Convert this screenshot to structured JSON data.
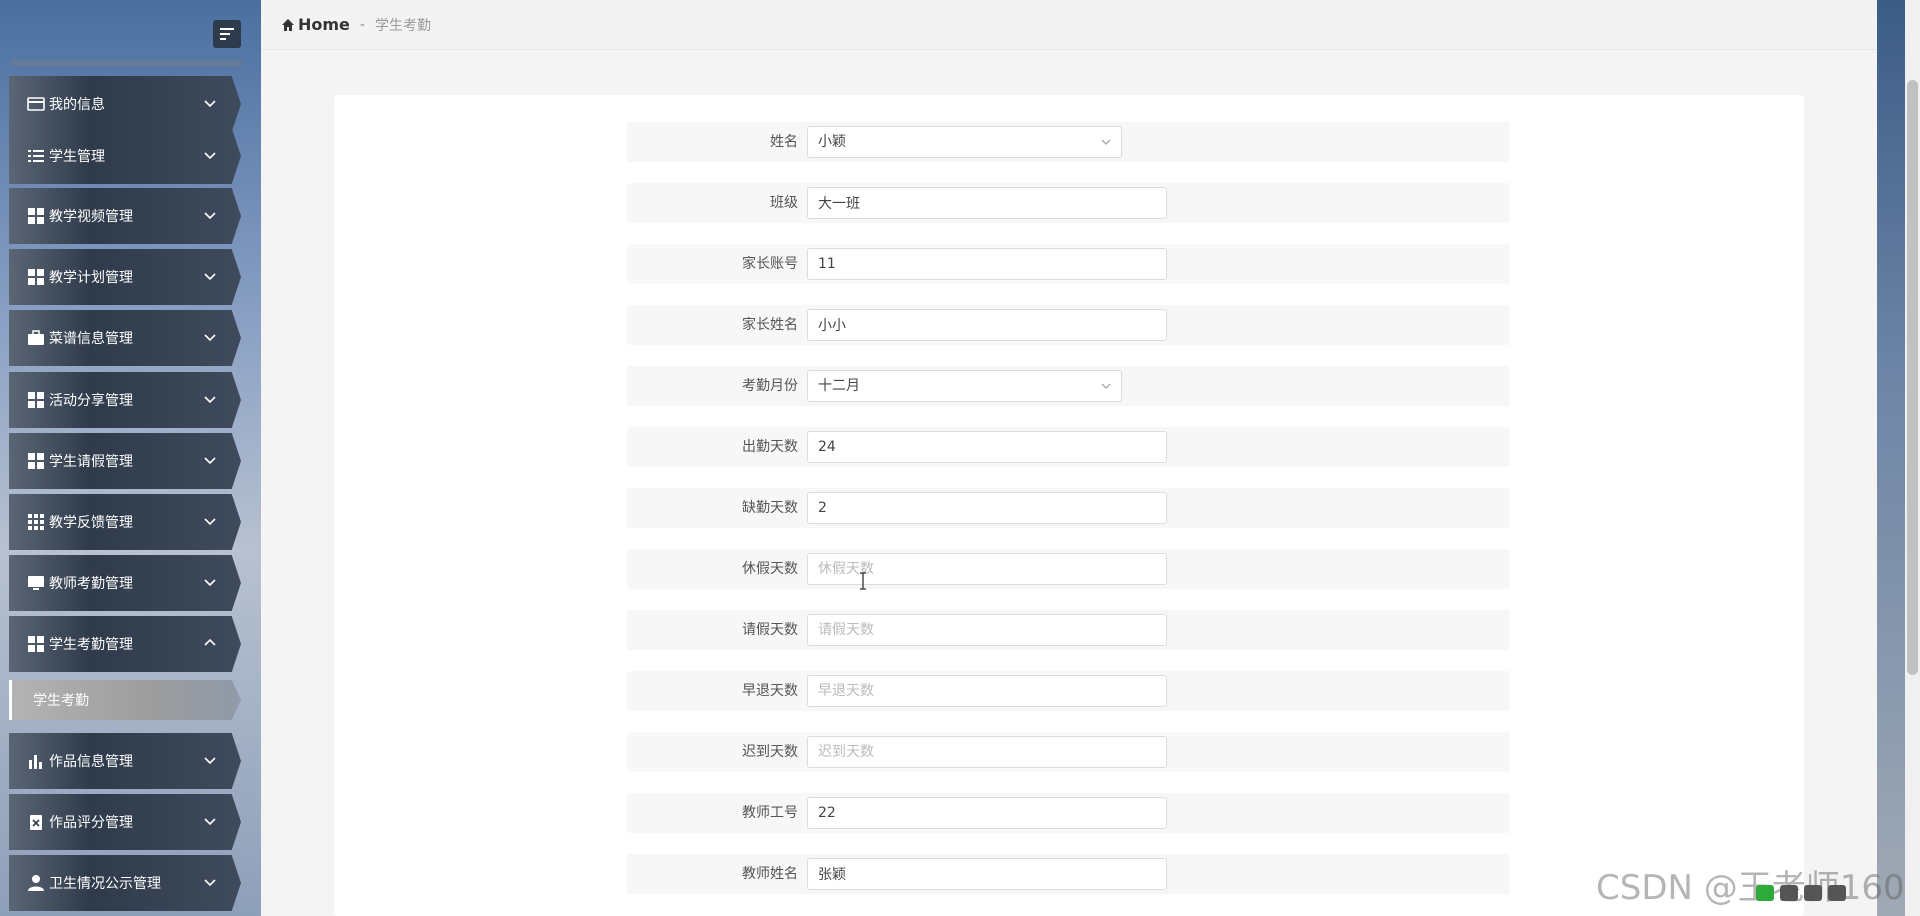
{
  "breadcrumb": {
    "home": "Home",
    "separator": "-",
    "current": "学生考勤"
  },
  "sidebar": {
    "items": [
      {
        "label": "我的信息",
        "icon": "wallet-icon"
      },
      {
        "label": "学生管理",
        "icon": "list-icon"
      },
      {
        "label": "教学视频管理",
        "icon": "grid-icon"
      },
      {
        "label": "教学计划管理",
        "icon": "grid-icon"
      },
      {
        "label": "菜谱信息管理",
        "icon": "briefcase-icon"
      },
      {
        "label": "活动分享管理",
        "icon": "grid-icon"
      },
      {
        "label": "学生请假管理",
        "icon": "grid-icon"
      },
      {
        "label": "教学反馈管理",
        "icon": "grid-3x3-icon"
      },
      {
        "label": "教师考勤管理",
        "icon": "monitor-icon"
      },
      {
        "label": "学生考勤管理",
        "icon": "grid-icon",
        "expanded": true
      },
      {
        "label": "作品信息管理",
        "icon": "bar-chart-icon"
      },
      {
        "label": "作品评分管理",
        "icon": "clipboard-x-icon"
      },
      {
        "label": "卫生情况公示管理",
        "icon": "user-icon"
      }
    ],
    "sub_item": "学生考勤"
  },
  "form": {
    "fields": [
      {
        "label": "姓名",
        "type": "select",
        "value": "小颖",
        "placeholder": ""
      },
      {
        "label": "班级",
        "type": "input",
        "value": "大一班",
        "placeholder": ""
      },
      {
        "label": "家长账号",
        "type": "input",
        "value": "11",
        "placeholder": ""
      },
      {
        "label": "家长姓名",
        "type": "input",
        "value": "小小",
        "placeholder": ""
      },
      {
        "label": "考勤月份",
        "type": "select",
        "value": "十二月",
        "placeholder": ""
      },
      {
        "label": "出勤天数",
        "type": "input",
        "value": "24",
        "placeholder": ""
      },
      {
        "label": "缺勤天数",
        "type": "input",
        "value": "2",
        "placeholder": ""
      },
      {
        "label": "休假天数",
        "type": "input",
        "value": "",
        "placeholder": "休假天数"
      },
      {
        "label": "请假天数",
        "type": "input",
        "value": "",
        "placeholder": "请假天数"
      },
      {
        "label": "早退天数",
        "type": "input",
        "value": "",
        "placeholder": "早退天数"
      },
      {
        "label": "迟到天数",
        "type": "input",
        "value": "",
        "placeholder": "迟到天数"
      },
      {
        "label": "教师工号",
        "type": "input",
        "value": "22",
        "placeholder": ""
      },
      {
        "label": "教师姓名",
        "type": "input",
        "value": "张颖",
        "placeholder": ""
      }
    ]
  },
  "watermark": "CSDN @王老师160"
}
